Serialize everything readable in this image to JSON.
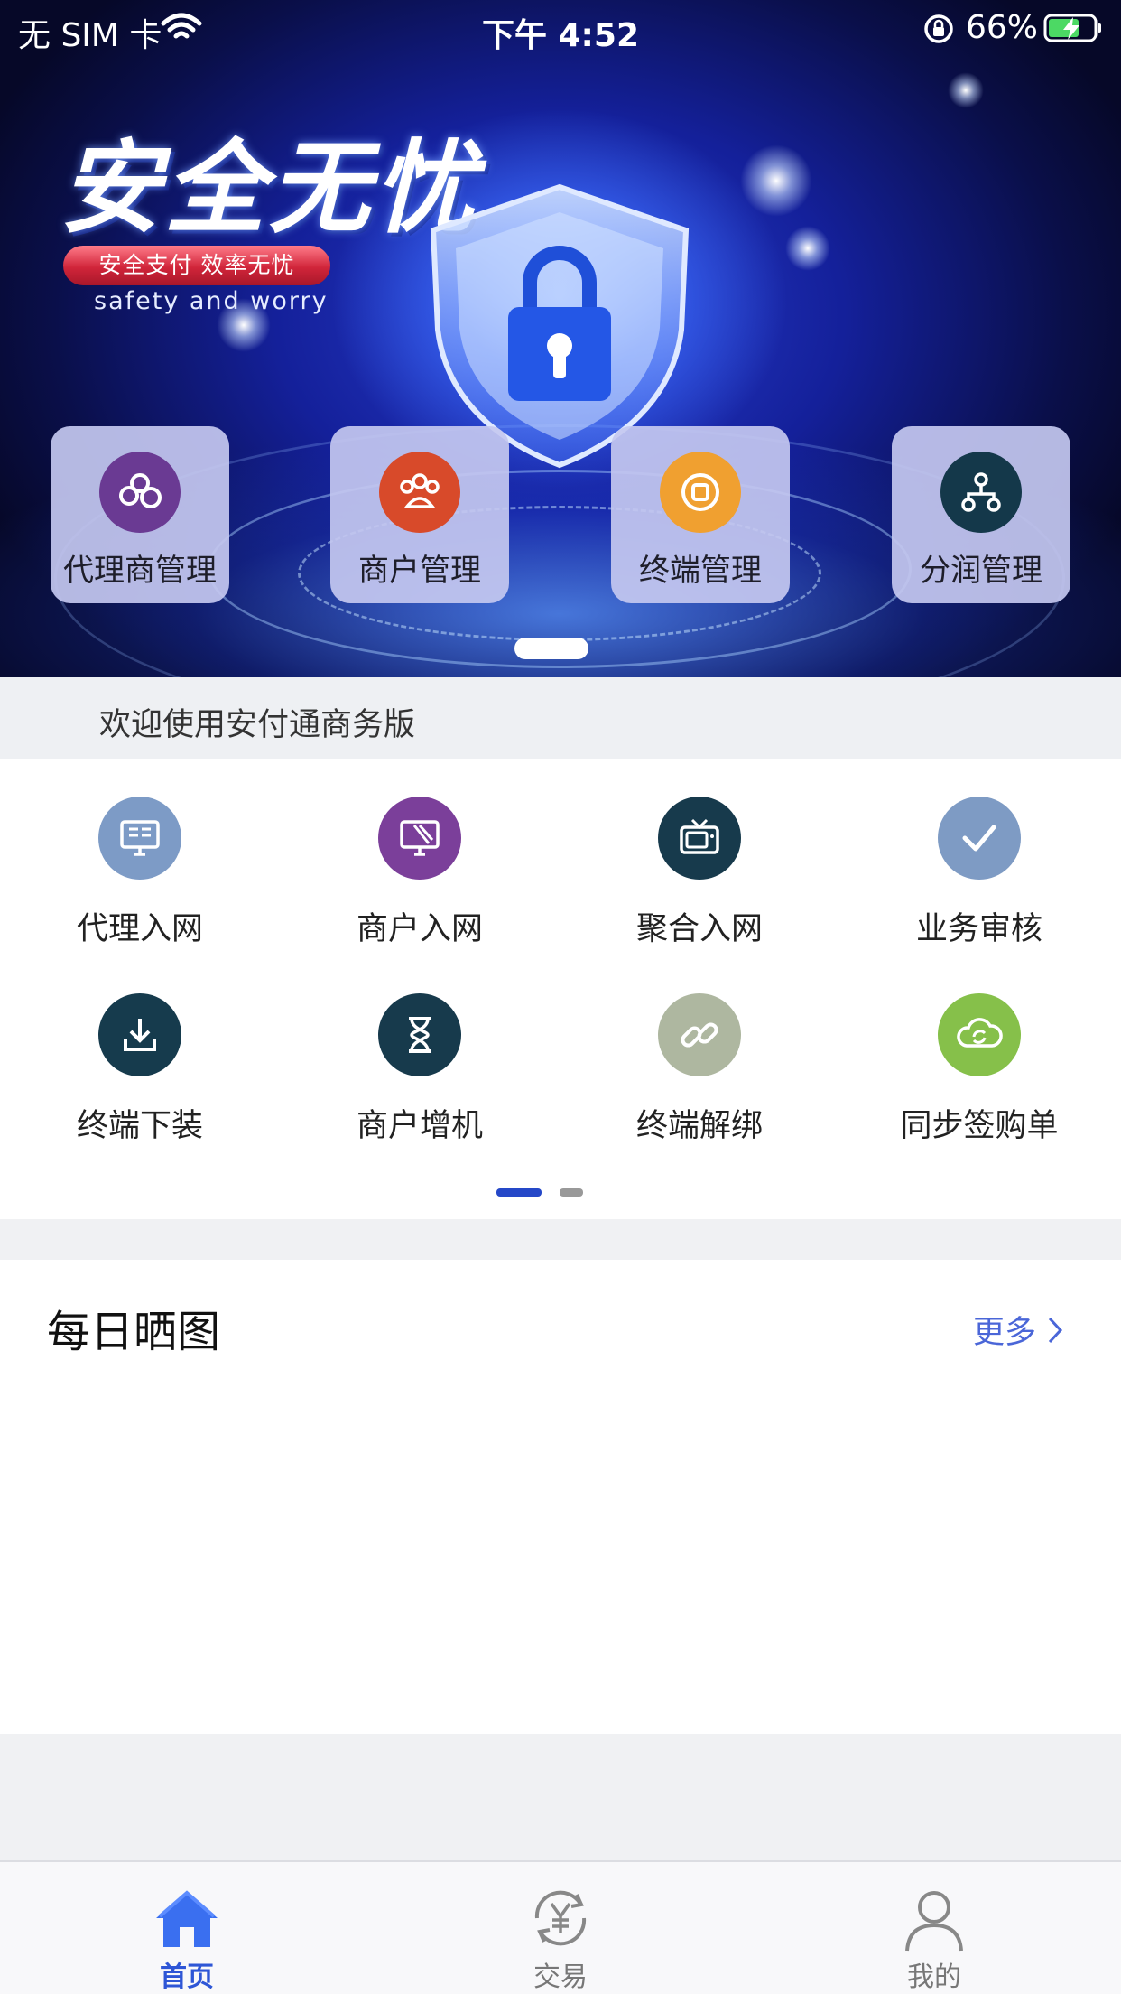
{
  "status_bar": {
    "carrier": "无 SIM 卡",
    "time": "下午 4:52",
    "battery_percent": "66%"
  },
  "banner": {
    "title": "安全无忧",
    "pill_text": "安全支付  效率无忧",
    "subtitle": "safety and worry",
    "cards": [
      {
        "label": "代理商管理",
        "icon": "agents-icon",
        "color": "#6a3a93"
      },
      {
        "label": "商户管理",
        "icon": "merchants-icon",
        "color": "#d84a2a"
      },
      {
        "label": "终端管理",
        "icon": "terminal-icon",
        "color": "#f0a030"
      },
      {
        "label": "分润管理",
        "icon": "profit-share-icon",
        "color": "#14384a"
      }
    ]
  },
  "welcome": {
    "text": "欢迎使用安付通商务版"
  },
  "grid": {
    "items": [
      {
        "label": "代理入网",
        "icon": "monitor-icon",
        "color": "#7d9bc6"
      },
      {
        "label": "商户入网",
        "icon": "screen-icon",
        "color": "#7b3f9a"
      },
      {
        "label": "聚合入网",
        "icon": "tv-icon",
        "color": "#173a4c"
      },
      {
        "label": "业务审核",
        "icon": "check-icon",
        "color": "#7e9bc4"
      },
      {
        "label": "终端下装",
        "icon": "download-icon",
        "color": "#163b4d"
      },
      {
        "label": "商户增机",
        "icon": "hourglass-icon",
        "color": "#173a4c"
      },
      {
        "label": "终端解绑",
        "icon": "link-icon",
        "color": "#aeb7a0"
      },
      {
        "label": "同步签购单",
        "icon": "cloud-sync-icon",
        "color": "#86c04a"
      }
    ],
    "page": 1,
    "page_count": 2
  },
  "daily": {
    "title": "每日晒图",
    "more_label": "更多"
  },
  "tabbar": {
    "tabs": [
      {
        "label": "首页",
        "icon": "home-icon",
        "active": true
      },
      {
        "label": "交易",
        "icon": "yuan-exchange-icon",
        "active": false
      },
      {
        "label": "我的",
        "icon": "user-icon",
        "active": false
      }
    ]
  },
  "colors": {
    "accent": "#2e56d6",
    "link": "#4a66d8"
  }
}
